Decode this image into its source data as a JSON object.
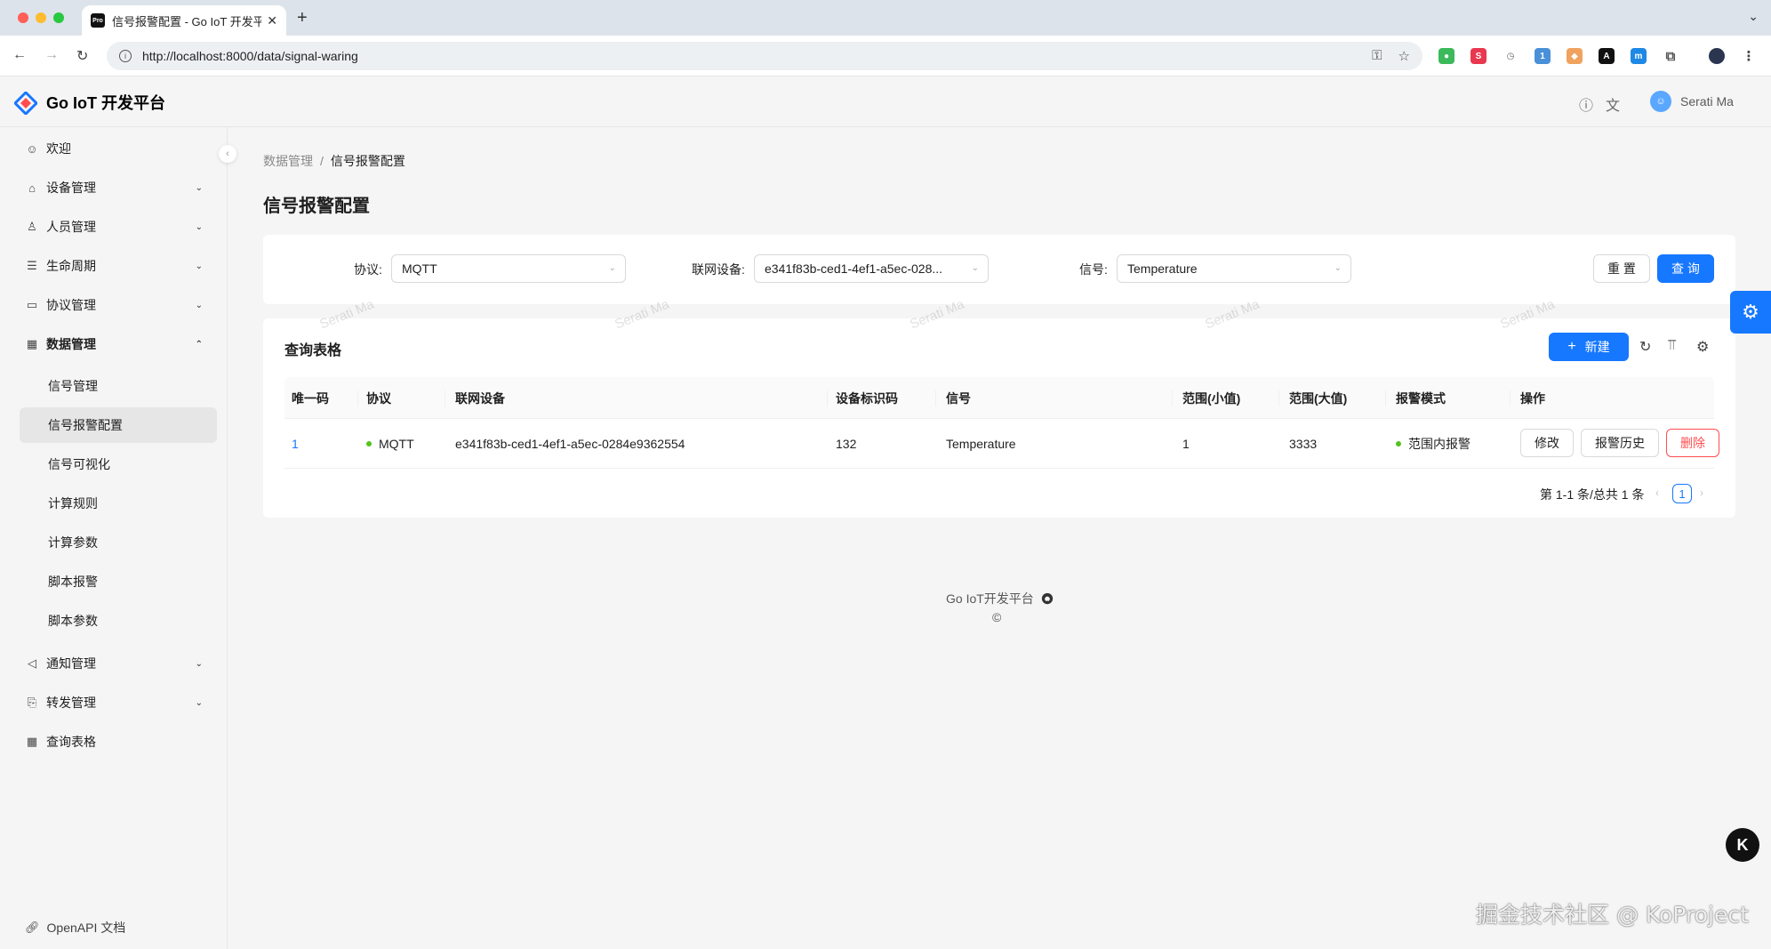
{
  "browser": {
    "tab_title": "信号报警配置 - Go IoT 开发平台",
    "tab_favicon": "Pro",
    "url": "http://localhost:8000/data/signal-waring",
    "extension_badge": "1"
  },
  "header": {
    "brand": "Go IoT 开发平台",
    "username": "Serati Ma",
    "icons": [
      "question-circle-icon",
      "translate-icon"
    ]
  },
  "sidebar": {
    "items": [
      {
        "label": "欢迎",
        "icon": "smile-icon"
      },
      {
        "label": "设备管理",
        "icon": "home-icon"
      },
      {
        "label": "人员管理",
        "icon": "user-icon"
      },
      {
        "label": "生命周期",
        "icon": "list-icon"
      },
      {
        "label": "协议管理",
        "icon": "card-icon"
      },
      {
        "label": "数据管理",
        "icon": "table-icon"
      },
      {
        "label": "通知管理",
        "icon": "notification-icon"
      },
      {
        "label": "转发管理",
        "icon": "forward-icon"
      },
      {
        "label": "查询表格",
        "icon": "table-icon"
      }
    ],
    "sub_items": [
      "信号管理",
      "信号报警配置",
      "信号可视化",
      "计算规则",
      "计算参数",
      "脚本报警",
      "脚本参数"
    ],
    "footer_link": "OpenAPI 文档"
  },
  "breadcrumb": {
    "parent": "数据管理",
    "separator": "/",
    "current": "信号报警配置"
  },
  "page_title": "信号报警配置",
  "filter": {
    "protocol_label": "协议:",
    "protocol_value": "MQTT",
    "device_label": "联网设备:",
    "device_value": "e341f83b-ced1-4ef1-a5ec-028...",
    "signal_label": "信号:",
    "signal_value": "Temperature",
    "reset_label": "重 置",
    "query_label": "查 询"
  },
  "table": {
    "title": "查询表格",
    "new_label": "新建",
    "columns": [
      "唯一码",
      "协议",
      "联网设备",
      "设备标识码",
      "信号",
      "范围(小值)",
      "范围(大值)",
      "报警模式",
      "操作"
    ],
    "rows": [
      {
        "id": "1",
        "protocol": "MQTT",
        "device": "e341f83b-ced1-4ef1-a5ec-0284e9362554",
        "device_code": "132",
        "signal": "Temperature",
        "min": "1",
        "max": "3333",
        "mode": "范围内报警",
        "actions": [
          "修改",
          "报警历史",
          "删除"
        ]
      }
    ],
    "pagination": {
      "summary": "第 1-1 条/总共 1 条",
      "current_page": "1"
    }
  },
  "watermark": "Serati Ma",
  "footer": {
    "text": "Go IoT开发平台",
    "copyright": "©"
  },
  "overlay_text": "掘金技术社区 @ KoProject",
  "colors": {
    "primary": "#1677ff",
    "danger": "#ff4d4f",
    "success": "#52c41a"
  }
}
